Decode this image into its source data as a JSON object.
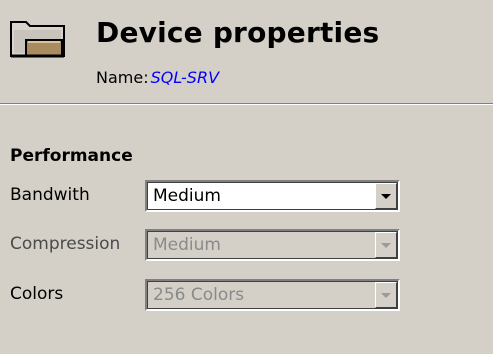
{
  "header": {
    "title": "Device properties",
    "name_label": "Name:",
    "name_value": "SQL-SRV",
    "icon": "folder-icon"
  },
  "performance": {
    "section_title": "Performance",
    "fields": [
      {
        "label": "Bandwith",
        "value": "Medium",
        "enabled": true
      },
      {
        "label": "Compression",
        "value": "Medium",
        "enabled": false
      },
      {
        "label": "Colors",
        "value": "256 Colors",
        "enabled": false
      }
    ]
  },
  "colors": {
    "background": "#d4d0c8",
    "name_value": "#0000ff",
    "disabled_text": "#8a8a8a"
  }
}
